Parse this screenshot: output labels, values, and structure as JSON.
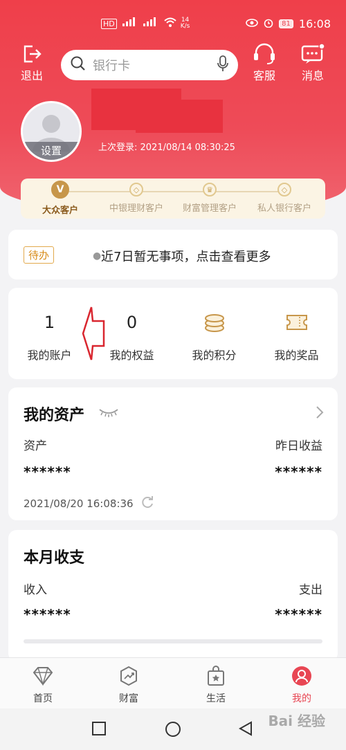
{
  "status_bar": {
    "left_badge": "HD",
    "net_speed_value": "14",
    "net_speed_unit": "K/s",
    "battery": "81",
    "time": "16:08"
  },
  "top_bar": {
    "logout_label": "退出",
    "search_placeholder": "银行卡",
    "service_label": "客服",
    "message_label": "消息"
  },
  "profile": {
    "settings_label": "设置",
    "last_login": "上次登录: 2021/08/14 08:30:25"
  },
  "levels": [
    {
      "label": "大众客户",
      "active": true,
      "icon": "V"
    },
    {
      "label": "中银理财客户",
      "active": false,
      "icon": "◇"
    },
    {
      "label": "财富管理客户",
      "active": false,
      "icon": "♛"
    },
    {
      "label": "私人银行客户",
      "active": false,
      "icon": "◇"
    }
  ],
  "todo": {
    "tag": "待办",
    "message": "近7日暂无事项，点击查看更多"
  },
  "stats": [
    {
      "value": "1",
      "label": "我的账户"
    },
    {
      "value": "0",
      "label": "我的权益"
    },
    {
      "icon": "coins-icon",
      "label": "我的积分"
    },
    {
      "icon": "ticket-icon",
      "label": "我的奖品"
    }
  ],
  "assets": {
    "title": "我的资产",
    "asset_label": "资产",
    "yesterday_label": "昨日收益",
    "asset_value": "******",
    "yesterday_value": "******",
    "timestamp": "2021/08/20 16:08:36"
  },
  "monthly": {
    "title": "本月收支",
    "income_label": "收入",
    "expense_label": "支出",
    "income_value": "******",
    "expense_value": "******"
  },
  "tabs": [
    {
      "label": "首页",
      "icon": "diamond-icon",
      "active": false
    },
    {
      "label": "财富",
      "icon": "trend-icon",
      "active": false
    },
    {
      "label": "生活",
      "icon": "bag-icon",
      "active": false
    },
    {
      "label": "我的",
      "icon": "user-icon",
      "active": true
    }
  ],
  "watermark": "Bai 经验",
  "colors": {
    "brand": "#e84653",
    "gold": "#c7964a"
  }
}
